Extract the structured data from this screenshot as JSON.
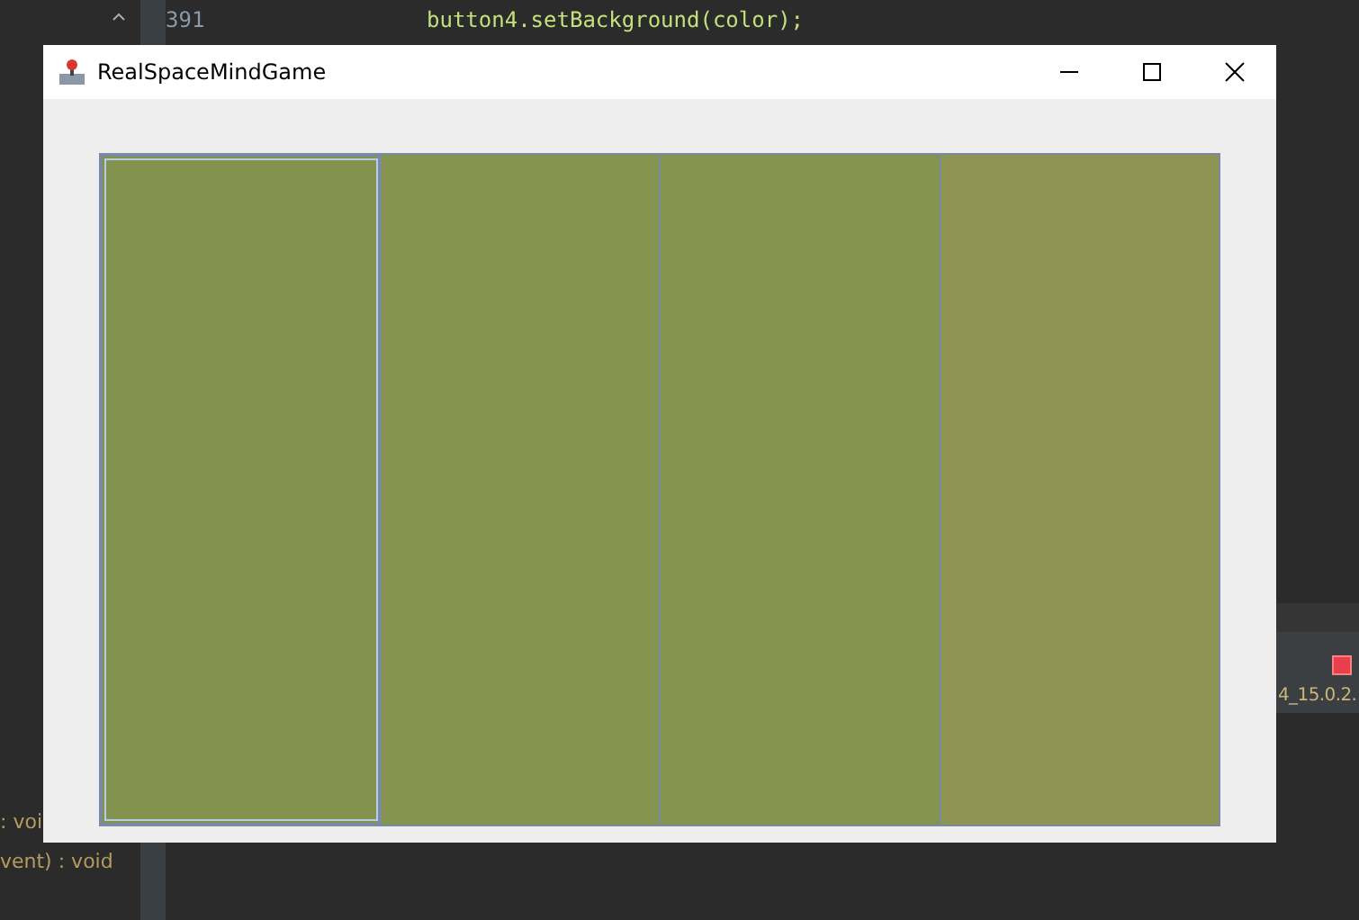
{
  "background_editor": {
    "line_number": "391",
    "code_line": "button4.setBackground(color);",
    "outline_items": [
      ": voi",
      "vent) : void"
    ],
    "console_tab": "4_15.0.2."
  },
  "window": {
    "title": "RealSpaceMindGame"
  },
  "buttons": [
    {
      "color": "#84924f",
      "selected": true
    },
    {
      "color": "#84944f",
      "selected": false
    },
    {
      "color": "#84944f",
      "selected": false
    },
    {
      "color": "#8f9455",
      "selected": false
    }
  ]
}
